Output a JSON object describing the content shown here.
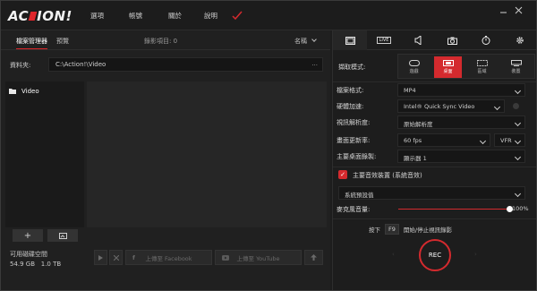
{
  "app": {
    "logo_text_a": "AC",
    "logo_text_b": "ION",
    "logo_bang": "!"
  },
  "menu": [
    "選項",
    "帳號",
    "關於",
    "說明"
  ],
  "left": {
    "tabs": [
      "檔案管理器",
      "預覽"
    ],
    "count_label": "錄影項目: 0",
    "sort_label": "名稱",
    "path_label": "資料夾:",
    "path_value": "C:\\Action!\\Video",
    "path_more": "...",
    "folders": [
      {
        "name": "Video"
      }
    ],
    "add_label": "+",
    "free_space_label": "可用磁碟空間",
    "free_space_value": "54.9 GB",
    "total_space_value": "1.0 TB",
    "upload_facebook": "上傳至 Facebook",
    "upload_youtube": "上傳至 YouTube"
  },
  "right": {
    "live_label": "LIVE",
    "capture_mode_label": "擷取模式:",
    "modes": [
      {
        "label": "遊戲",
        "icon": "gamepad-icon"
      },
      {
        "label": "桌面",
        "icon": "desktop-icon"
      },
      {
        "label": "區域",
        "icon": "region-icon"
      },
      {
        "label": "裝置",
        "icon": "device-icon"
      }
    ],
    "active_mode": 1,
    "rows": {
      "file_format": {
        "label": "檔案格式:",
        "value": "MP4"
      },
      "hw_accel": {
        "label": "硬體加速:",
        "value": "Intel® Quick Sync Video"
      },
      "resolution": {
        "label": "視訊解析度:",
        "value": "原始解析度"
      },
      "framerate": {
        "label": "畫面更新率:",
        "value": "60 fps",
        "mode": "VFR"
      },
      "monitor": {
        "label": "主要桌面錄製:",
        "value": "顯示器 1"
      },
      "audio_device": {
        "label": "主要音效裝置 (系統音效)",
        "checked": true
      },
      "audio_default": {
        "value": "系統預設值"
      },
      "mic_volume": {
        "label": "麥克風音量:",
        "value": "100%",
        "level": 1.0
      }
    },
    "hotkey": {
      "prefix": "按下",
      "key": "F9",
      "suffix": "開始/停止視訊錄影"
    },
    "rec_label": "REC"
  },
  "colors": {
    "accent": "#d42a2e",
    "bg": "#1d1d1d"
  }
}
